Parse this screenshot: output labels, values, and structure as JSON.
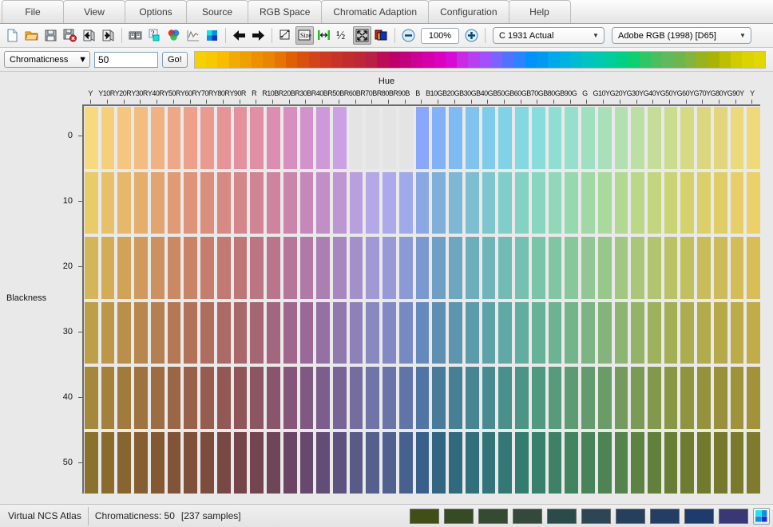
{
  "window": {
    "title": "Virtual NCS Atlas"
  },
  "menubar": {
    "items": [
      {
        "label": "File",
        "name": "menu-file"
      },
      {
        "label": "View",
        "name": "menu-view"
      },
      {
        "label": "Options",
        "name": "menu-options"
      },
      {
        "label": "Source",
        "name": "menu-source"
      },
      {
        "label": "RGB Space",
        "name": "menu-rgb-space"
      },
      {
        "label": "Chromatic Adaption",
        "name": "menu-chromatic-adaption"
      },
      {
        "label": "Configuration",
        "name": "menu-configuration"
      },
      {
        "label": "Help",
        "name": "menu-help"
      }
    ]
  },
  "toolbar": {
    "icons": [
      {
        "name": "new-document-icon"
      },
      {
        "name": "open-folder-icon"
      },
      {
        "name": "save-icon"
      },
      {
        "name": "save-delete-icon"
      },
      {
        "name": "import-arrow-icon"
      },
      {
        "name": "export-arrow-icon"
      },
      {
        "name": "book-icon"
      },
      {
        "name": "help-query-icon"
      },
      {
        "name": "color-wheel-icon"
      },
      {
        "name": "curve-graph-icon"
      },
      {
        "name": "palette-icon"
      },
      {
        "name": "back-arrow-icon"
      },
      {
        "name": "forward-arrow-icon"
      },
      {
        "name": "fit-page-icon"
      },
      {
        "name": "actual-size-icon"
      },
      {
        "name": "fit-width-icon"
      },
      {
        "name": "half-size-icon"
      },
      {
        "name": "fullscreen-icon"
      },
      {
        "name": "layers-color-icon"
      }
    ],
    "zoom_out_label": "−",
    "zoom_in_label": "+",
    "zoom_value": "100%",
    "observer_select": "C 1931 Actual",
    "rgb_space_select": "Adobe RGB (1998) [D65]",
    "dropdown_arrow": "▼"
  },
  "chroma_bar": {
    "mode_select": "Chromaticness",
    "value": "50",
    "go_label": "Go!",
    "dropdown_arrow": "▼",
    "hue_strip_colors": [
      "#f7d000",
      "#f8c800",
      "#f8bc00",
      "#f2ab00",
      "#ef9f00",
      "#ec9000",
      "#ea8500",
      "#e57400",
      "#df5f05",
      "#d9500f",
      "#d24419",
      "#cd3a20",
      "#c73326",
      "#c22d2b",
      "#bd2838",
      "#ba1f45",
      "#bb0d55",
      "#bd006a",
      "#c2007f",
      "#cc0094",
      "#d600ab",
      "#dc00c0",
      "#d70bd6",
      "#c92ae2",
      "#b83ff0",
      "#9f52fb",
      "#7a63ff",
      "#5172ff",
      "#2b83ff",
      "#0092f8",
      "#009bf0",
      "#00a8ec",
      "#00b2e0",
      "#00bcd2",
      "#00c4c2",
      "#00c9b0",
      "#00cd9c",
      "#00cf88",
      "#0ccf72",
      "#2ec763",
      "#4cbe5e",
      "#60b95b",
      "#6fb54d",
      "#84b33f",
      "#99b220",
      "#a8b500",
      "#bcc000",
      "#cfcc00",
      "#dbd400",
      "#e2d800"
    ]
  },
  "plot": {
    "x_axis_title": "Hue",
    "y_axis_title": "Blackness",
    "y_ticks": [
      "0",
      "10",
      "20",
      "30",
      "40",
      "50"
    ],
    "hue_labels": [
      "Y",
      "Y10R",
      "Y20R",
      "Y30R",
      "Y40R",
      "Y50R",
      "Y60R",
      "Y70R",
      "Y80R",
      "Y90R",
      "R",
      "R10B",
      "R20B",
      "R30B",
      "R40B",
      "R50B",
      "R60B",
      "R70B",
      "R80B",
      "R90B",
      "B",
      "B10G",
      "B20G",
      "B30G",
      "B40G",
      "B50G",
      "B60G",
      "B70G",
      "B80G",
      "B90G",
      "G",
      "G10Y",
      "G20Y",
      "G30Y",
      "G40Y",
      "G50Y",
      "G60Y",
      "G70Y",
      "G80Y",
      "G90Y",
      "Y"
    ]
  },
  "chart_data": {
    "type": "heatmap",
    "title": "Virtual NCS Atlas — Chromaticness 50",
    "xlabel": "Hue",
    "ylabel": "Blackness",
    "xtick_labels": [
      "Y",
      "Y10R",
      "Y20R",
      "Y30R",
      "Y40R",
      "Y50R",
      "Y60R",
      "Y70R",
      "Y80R",
      "Y90R",
      "R",
      "R10B",
      "R20B",
      "R30B",
      "R40B",
      "R50B",
      "R60B",
      "R70B",
      "R80B",
      "R90B",
      "B",
      "B10G",
      "B20G",
      "B30G",
      "B40G",
      "B50G",
      "B60G",
      "B70G",
      "B80G",
      "B90G",
      "G",
      "G10Y",
      "G20Y",
      "G30Y",
      "G40Y",
      "G50Y",
      "G60Y",
      "G70Y",
      "G80Y",
      "G90Y",
      "Y"
    ],
    "ytick_labels": [
      "0",
      "10",
      "20",
      "30",
      "40",
      "50"
    ],
    "ylim": [
      0,
      50
    ],
    "sample_count": 237,
    "grid": false,
    "legend": "none",
    "rows": [
      {
        "blackness": 0,
        "colors": [
          "#f7da7e",
          "#f6cf7d",
          "#f5c67f",
          "#f3bc80",
          "#f1b283",
          "#efa887",
          "#eda18a",
          "#ea9a90",
          "#e69496",
          "#e3919c",
          "#e08fa5",
          "#dd8eb0",
          "#d98fbd",
          "#d492cc",
          "#cf98d9",
          "#cba0e5",
          "#e4e4e4",
          "#e4e4e4",
          "#e4e4e4",
          "#e4e4e4",
          "#8ba6fd",
          "#83b1f7",
          "#80baf2",
          "#7fc3ee",
          "#7fcbeb",
          "#80d2e7",
          "#83d8e2",
          "#88dcdc",
          "#8fded4",
          "#96dfcc",
          "#9fe0c3",
          "#a9e0ba",
          "#b2e0af",
          "#bbdfa4",
          "#c4de9a",
          "#ccdc8e",
          "#d5da85",
          "#dcd77e",
          "#e3d57c",
          "#eada7c",
          "#f0d97b"
        ]
      },
      {
        "blackness": 10,
        "colors": [
          "#e9cb69",
          "#e7c169",
          "#e6b86b",
          "#e4ae6d",
          "#e2a470",
          "#e09b74",
          "#de9478",
          "#db8e7e",
          "#d78984",
          "#d4868a",
          "#d18493",
          "#ce849e",
          "#ca85ab",
          "#c588b9",
          "#c18ec6",
          "#bd96d2",
          "#b99fdd",
          "#b5a8e7",
          "#ada9ea",
          "#9eaae9",
          "#8aa9e4",
          "#80b0d9",
          "#7db7d3",
          "#7dbfd0",
          "#7ec6cd",
          "#80cdc9",
          "#84d2c4",
          "#89d6be",
          "#90d8b7",
          "#97d9af",
          "#a0d9a6",
          "#a9d99d",
          "#b2d992",
          "#bbd888",
          "#c3d67e",
          "#cbd474",
          "#d3d26c",
          "#dacf68",
          "#e0cd68",
          "#e6cf68",
          "#ecd069"
        ]
      },
      {
        "blackness": 20,
        "colors": [
          "#d4b557",
          "#d2ac57",
          "#d1a359",
          "#cf9a5c",
          "#cd915f",
          "#cb8963",
          "#c98367",
          "#c67d6d",
          "#c27973",
          "#bf7679",
          "#bc7582",
          "#b9758c",
          "#b57699",
          "#b079a6",
          "#ac7fb3",
          "#a887be",
          "#a490c9",
          "#a099d3",
          "#9899d6",
          "#8b9ad5",
          "#7999d0",
          "#709fc5",
          "#6ea6bf",
          "#6eaebb",
          "#6fb5b8",
          "#71bbb4",
          "#75c0b0",
          "#7ac4aa",
          "#81c6a4",
          "#88c79c",
          "#90c794",
          "#98c78c",
          "#a1c782",
          "#aac678",
          "#b2c46f",
          "#bac265",
          "#c1c05e",
          "#c8bd5a",
          "#cdbb59",
          "#d3bd58",
          "#d9be57"
        ]
      },
      {
        "blackness": 30,
        "colors": [
          "#bd9f49",
          "#bc9749",
          "#ba8f4b",
          "#b8874e",
          "#b67f51",
          "#b47855",
          "#b27259",
          "#af6d5f",
          "#ab6a65",
          "#a8676b",
          "#a56674",
          "#a2667e",
          "#9e678b",
          "#996a97",
          "#9570a3",
          "#9178ad",
          "#8d81b7",
          "#8989c0",
          "#8289c3",
          "#768ac2",
          "#6689bd",
          "#5e8fb3",
          "#5c95ad",
          "#5c9caa",
          "#5da2a7",
          "#5fa8a3",
          "#62ad9f",
          "#67b199",
          "#6db393",
          "#74b48b",
          "#7cb484",
          "#84b47c",
          "#8cb472",
          "#95b368",
          "#9db15f",
          "#a4af55",
          "#abad4f",
          "#b1ab4b",
          "#b6a94a",
          "#bbab49",
          "#c0ac49"
        ]
      },
      {
        "blackness": 40,
        "colors": [
          "#a4883b",
          "#a3813b",
          "#a17a3d",
          "#9f733f",
          "#9d6c42",
          "#9b6646",
          "#996149",
          "#965c4f",
          "#925954",
          "#8f565a",
          "#8c5562",
          "#89556b",
          "#855677",
          "#805982",
          "#7c5e8c",
          "#786595",
          "#746d9e",
          "#7074a6",
          "#6a74a8",
          "#5f75a7",
          "#5074a3",
          "#497a9a",
          "#477f94",
          "#478591",
          "#488b8e",
          "#4a908a",
          "#4d9486",
          "#519881",
          "#579a7c",
          "#5d9b75",
          "#649b6e",
          "#6b9b67",
          "#739b5e",
          "#7b9a55",
          "#82984d",
          "#899644",
          "#8f943f",
          "#95923c",
          "#99903b",
          "#9e923b",
          "#a2933b"
        ]
      },
      {
        "blackness": 50,
        "colors": [
          "#8a712e",
          "#896b2e",
          "#876530",
          "#855f32",
          "#835934",
          "#815437",
          "#7f503a",
          "#7c4c3f",
          "#784944",
          "#754649",
          "#724550",
          "#6f4558",
          "#6b4663",
          "#66496d",
          "#624d76",
          "#5e537e",
          "#5a5a86",
          "#56608d",
          "#50608f",
          "#47618e",
          "#39608a",
          "#336582",
          "#316a7d",
          "#316f7a",
          "#327477",
          "#337874",
          "#357c70",
          "#38806b",
          "#3d8266",
          "#428360",
          "#48835a",
          "#4e8354",
          "#55834c",
          "#5c8244",
          "#62803c",
          "#687e34",
          "#6d7c30",
          "#727a2d",
          "#76782d",
          "#7a7a2d",
          "#7e7b2e"
        ]
      }
    ]
  },
  "statusbar": {
    "app_label": "Virtual NCS Atlas",
    "chromaticness_label": "Chromaticness: 50",
    "samples_label": "[237 samples]",
    "swatches": [
      "#414e18",
      "#364a25",
      "#344b32",
      "#35483c",
      "#2b4b4b",
      "#2c4653",
      "#253f5d",
      "#233d63",
      "#1f3b6b",
      "#3a3874"
    ],
    "picker_icon": "palette-icon"
  }
}
